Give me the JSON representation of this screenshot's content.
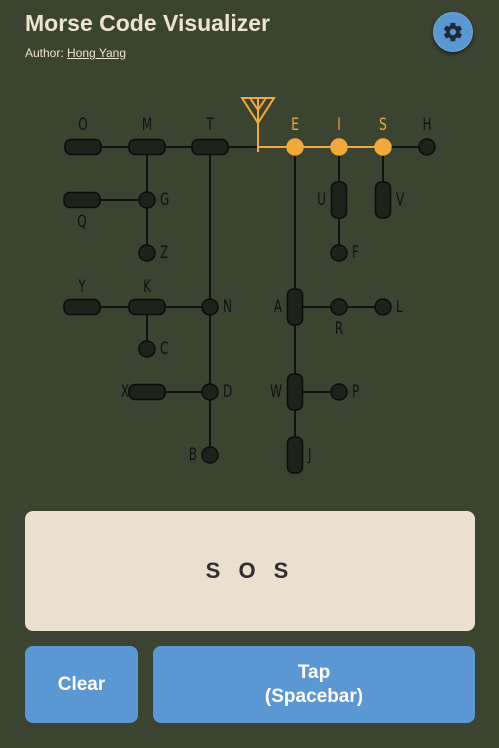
{
  "header": {
    "title": "Morse Code Visualizer",
    "author_prefix": "Author:",
    "author_name": "Hong Yang",
    "settings_icon": "gear-icon"
  },
  "colors": {
    "background": "#3b4431",
    "node": "#1f221b",
    "highlight": "#f2a93b",
    "accent": "#5b97d3",
    "display_bg": "#ebdfcd"
  },
  "tree": {
    "letters": [
      "E",
      "T",
      "I",
      "A",
      "N",
      "M",
      "S",
      "U",
      "R",
      "W",
      "D",
      "K",
      "G",
      "O",
      "H",
      "V",
      "F",
      "L",
      "P",
      "J",
      "B",
      "X",
      "C",
      "Y",
      "Z",
      "Q"
    ],
    "highlighted_letters": [
      "E",
      "I",
      "S"
    ],
    "antenna_icon": "antenna-icon"
  },
  "display": {
    "text": "S O S"
  },
  "buttons": {
    "clear_label": "Clear",
    "tap_label_line1": "Tap",
    "tap_label_line2": "(Spacebar)"
  }
}
